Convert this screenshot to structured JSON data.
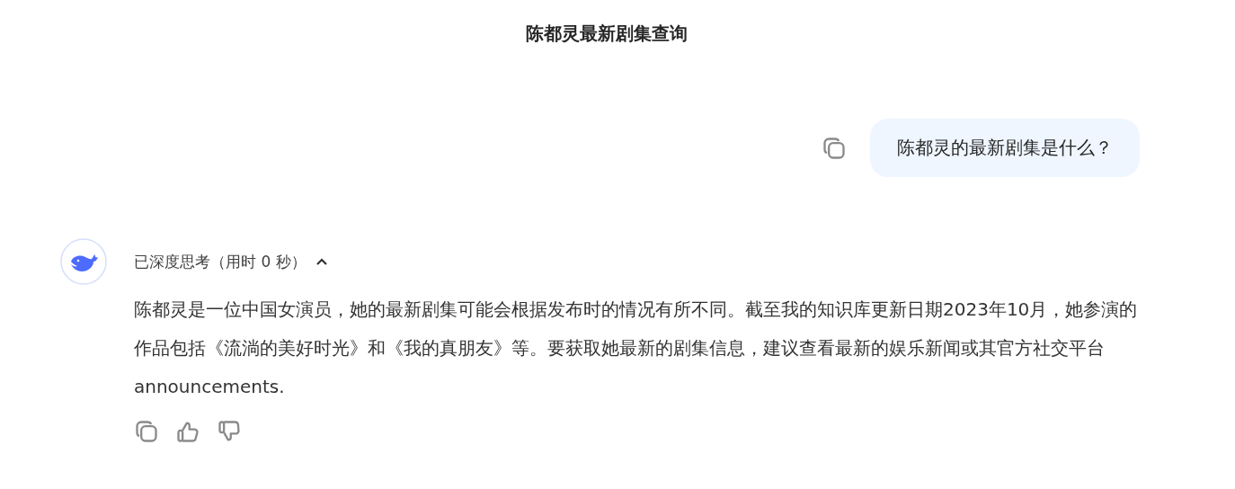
{
  "title": "陈都灵最新剧集查询",
  "user_message": {
    "text": "陈都灵的最新剧集是什么？"
  },
  "thinking": {
    "label": "已深度思考（用时 0 秒）",
    "expanded": true
  },
  "answer": {
    "text": "陈都灵是一位中国女演员，她的最新剧集可能会根据发布时的情况有所不同。截至我的知识库更新日期2023年10月，她参演的作品包括《流淌的美好时光》和《我的真朋友》等。要获取她最新的剧集信息，建议查看最新的娱乐新闻或其官方社交平台 announcements."
  }
}
